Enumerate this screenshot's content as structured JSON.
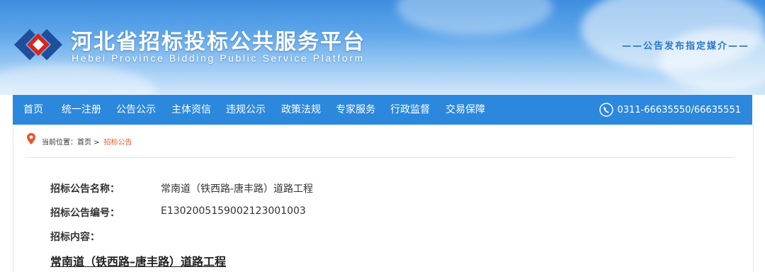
{
  "header": {
    "title": "河北省招标投标公共服务平台",
    "subtitle": "Hebei Province Bidding Public Service Platform",
    "slogan": "——公告发布指定媒介——"
  },
  "nav": {
    "items": [
      "首页",
      "统一注册",
      "公告公示",
      "主体资信",
      "违规公示",
      "政策法规",
      "专家服务",
      "行政监督",
      "交易保障"
    ],
    "phone": "0311-66635550/66635551"
  },
  "breadcrumb": {
    "prefix": "当前位置：首页 >",
    "current": "招标公告"
  },
  "notice": {
    "name_label": "招标公告名称：",
    "name_value": "常南道（铁西路-唐丰路）道路工程",
    "number_label": "招标公告编号：",
    "number_value": "E1302005159002123001003",
    "content_label": "招标内容：",
    "content_title": "常南道（铁西路–唐丰路）道路工程"
  },
  "colors": {
    "nav_bg": "#2c88dc",
    "accent": "#e8572b",
    "slogan": "#2b78c9"
  },
  "icons": [
    "logo-mark",
    "phone-icon",
    "location-pin-icon"
  ]
}
